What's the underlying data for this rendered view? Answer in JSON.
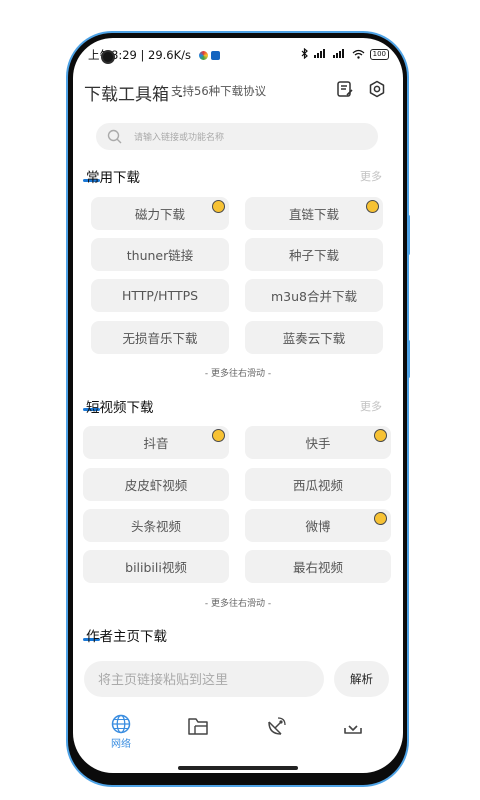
{
  "status_bar": {
    "time_speed": "上午8:29 | 29.6K/s",
    "battery": "100"
  },
  "header": {
    "title": "下载工具箱",
    "separator": "-",
    "subtitle": "支持56种下载协议"
  },
  "search": {
    "placeholder": "请输入链接或功能名称"
  },
  "sections": {
    "common": {
      "title": "常用下载",
      "more": "更多",
      "items": [
        "磁力下载",
        "直链下载",
        "thuner链接",
        "种子下载",
        "HTTP/HTTPS",
        "m3u8合并下载",
        "无损音乐下载",
        "蓝奏云下载"
      ],
      "hint": "- 更多往右滑动 -"
    },
    "short_video": {
      "title": "短视频下载",
      "more": "更多",
      "items": [
        "抖音",
        "快手",
        "皮皮虾视频",
        "西瓜视频",
        "头条视频",
        "微博",
        "bilibili视频",
        "最右视频"
      ],
      "hint": "- 更多往右滑动 -"
    },
    "author": {
      "title": "作者主页下载",
      "input_placeholder": "将主页链接粘贴到这里",
      "parse_label": "解析"
    }
  },
  "nav": {
    "items": [
      {
        "label": "网络",
        "icon": "globe-icon",
        "active": true
      },
      {
        "label": "",
        "icon": "folder-icon",
        "active": false
      },
      {
        "label": "",
        "icon": "satellite-icon",
        "active": false
      },
      {
        "label": "",
        "icon": "download-tray-icon",
        "active": false
      }
    ]
  },
  "colors": {
    "accent": "#3a8de0",
    "frame": "#4fa3e6",
    "badge": "#f7c234",
    "button_bg": "#f1f1f1"
  }
}
